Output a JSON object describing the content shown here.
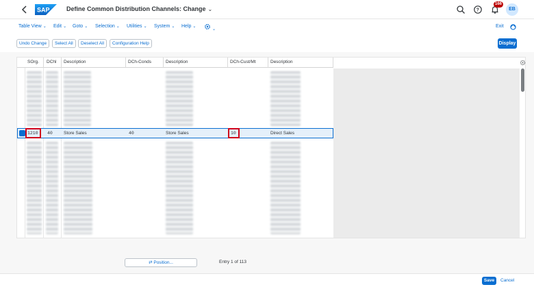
{
  "shell": {
    "title": "Define Common Distribution Channels: Change",
    "notification_count": "166",
    "avatar_initials": "EB",
    "logo_text": "SAP"
  },
  "menu": {
    "items": [
      "Table View",
      "Edit",
      "Goto",
      "Selection",
      "Utilities",
      "System",
      "Help"
    ],
    "exit_label": "Exit"
  },
  "toolbar": {
    "buttons": [
      "Undo Change",
      "Select All",
      "Deselect All",
      "Configuration Help"
    ],
    "display_label": "Display"
  },
  "table": {
    "columns": [
      "SOrg.",
      "DChl",
      "Description",
      "DCh-Conds",
      "Description",
      "DCh-Cust/Mt",
      "Description"
    ],
    "selected_row": {
      "sorg": "1210",
      "dchl": "40",
      "description": "Store Sales",
      "dch_conds": "40",
      "description2": "Store Sales",
      "dch_cust_mt": "10",
      "description3": "Direct Sales"
    }
  },
  "footer": {
    "position_label": "Position...",
    "entry_text": "Entry 1 of 113",
    "save_label": "Save",
    "cancel_label": "Cancel"
  },
  "colors": {
    "accent": "#0a6ed1",
    "highlight_border": "#d0021b",
    "badge": "#bb0000"
  }
}
